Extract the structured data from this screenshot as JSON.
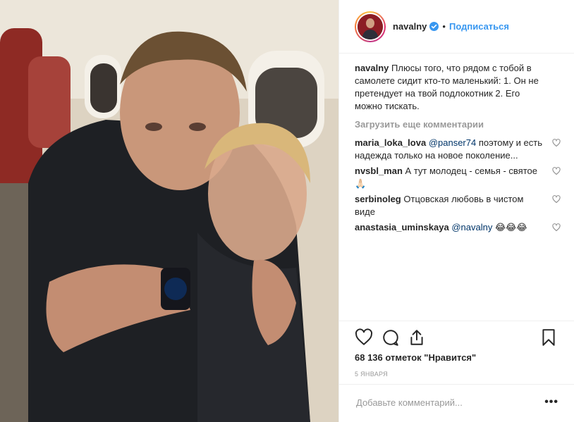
{
  "header": {
    "username": "navalny",
    "separator": "•",
    "follow_label": "Подписаться"
  },
  "caption": {
    "username": "navalny",
    "text": "Плюсы того, что рядом с тобой в самолете сидит кто-то маленький: 1. Он не претендует на твой подлокотник 2. Его можно тискать."
  },
  "load_more_label": "Загрузить еще комментарии",
  "comments": [
    {
      "username": "maria_loka_lova",
      "mention": "@panser74",
      "text": " поэтому и есть надежда только на новое поколение..."
    },
    {
      "username": "nvsbl_man",
      "mention": "",
      "text": "А тут молодец - семья - святое🙏🏻"
    },
    {
      "username": "serbinoleg",
      "mention": "",
      "text": "Отцовская любовь в чистом виде"
    },
    {
      "username": "anastasia_uminskaya",
      "mention": "@navalny",
      "text": " 😂😂😂"
    }
  ],
  "likes_text": "68 136 отметок \"Нравится\"",
  "date_text": "5 ЯНВАРЯ",
  "add_comment_placeholder": "Добавьте комментарий...",
  "more_label": "•••",
  "icons": [
    "heart-icon",
    "comment-icon",
    "share-icon",
    "bookmark-icon",
    "verified-icon"
  ],
  "colors": {
    "link": "#3897f0",
    "text": "#262626",
    "muted": "#999999",
    "mention": "#003569",
    "border": "#efefef"
  }
}
